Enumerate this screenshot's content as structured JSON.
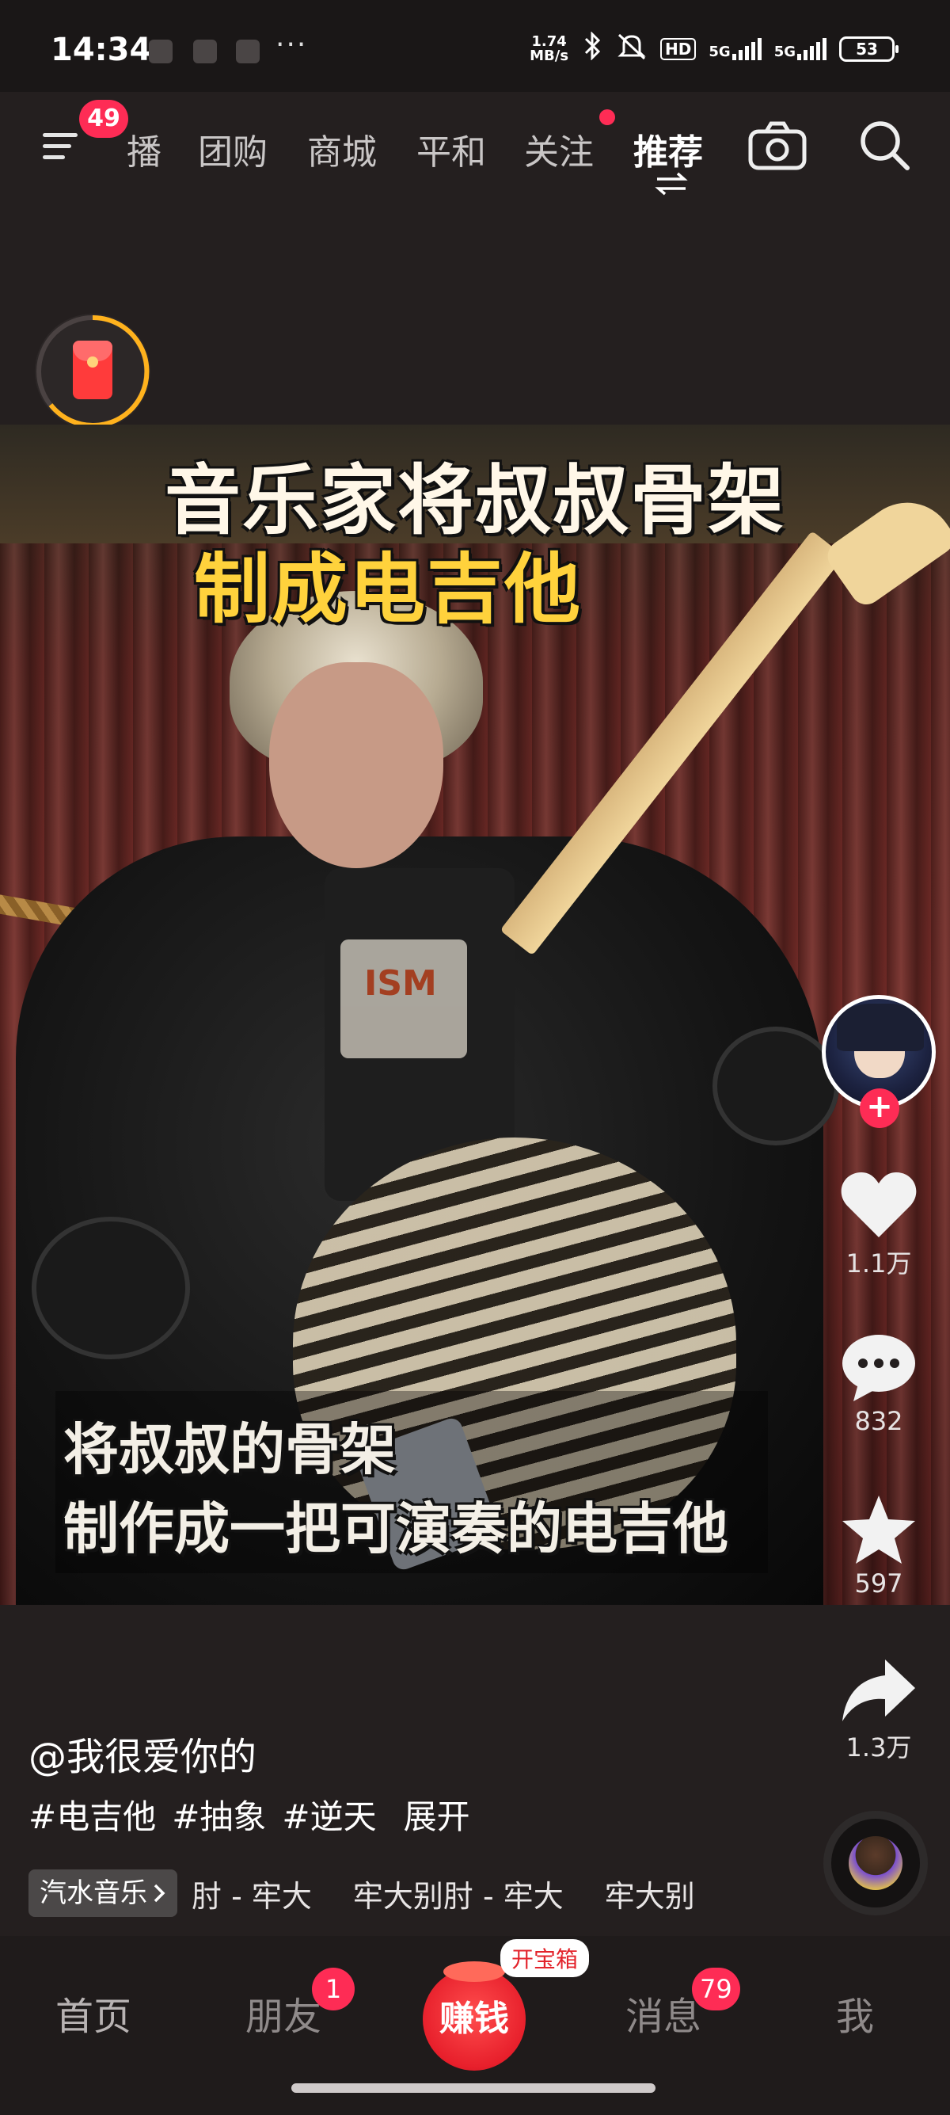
{
  "status_bar": {
    "time": "14:34",
    "speed_value": "1.74",
    "speed_unit": "MB/s",
    "network_1": "5G",
    "network_2": "5G",
    "hd_label": "HD",
    "battery": "53",
    "more": "···"
  },
  "top_nav": {
    "menu_badge": "49",
    "tabs": [
      {
        "label": "播",
        "active": false
      },
      {
        "label": "团购",
        "active": false
      },
      {
        "label": "商城",
        "active": false
      },
      {
        "label": "平和",
        "active": false
      },
      {
        "label": "关注",
        "active": false,
        "has_dot": true
      },
      {
        "label": "推荐",
        "active": true
      }
    ],
    "icons": [
      "menu-icon",
      "swap-icon",
      "camera-icon",
      "search-icon"
    ]
  },
  "video": {
    "headline_1": "音乐家将叔叔骨架",
    "headline_2": "制成电吉他",
    "subtitle_1": "将叔叔的骨架",
    "subtitle_2": "制作成一把可演奏的电吉他"
  },
  "actions": {
    "likes": "1.1万",
    "comments": "832",
    "favorites": "597",
    "shares": "1.3万"
  },
  "caption": {
    "author": "@我很爱你的",
    "tags": [
      "#电吉他",
      "#抽象",
      "#逆天"
    ],
    "expand": "展开"
  },
  "music": {
    "tag": "汽水音乐",
    "tracks": [
      "肘 - 牢大",
      "牢大别肘 - 牢大",
      "牢大别"
    ]
  },
  "bottom_nav": {
    "home": "首页",
    "friends": "朋友",
    "friends_badge": "1",
    "earn": "赚钱",
    "earn_tag": "开宝箱",
    "messages": "消息",
    "messages_badge": "79",
    "me": "我"
  },
  "colors": {
    "accent": "#fe2c55",
    "background": "#241f1f",
    "headline_yellow": "#ffd23c"
  }
}
